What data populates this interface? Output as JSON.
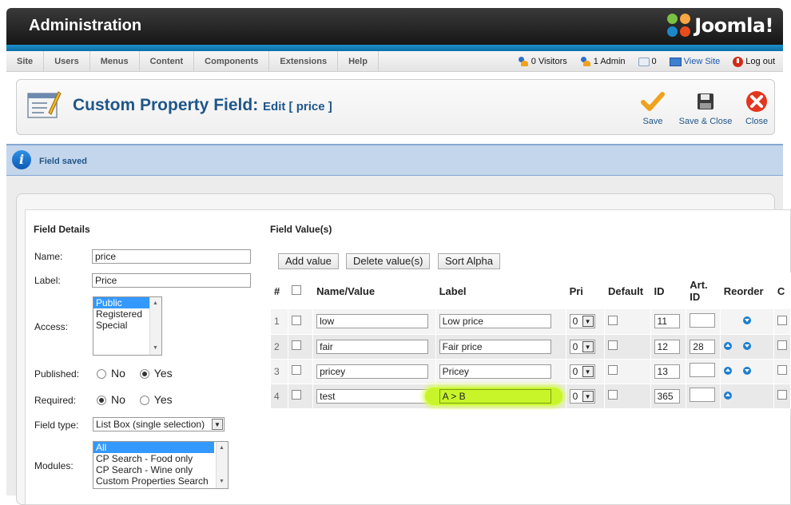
{
  "header": {
    "title": "Administration",
    "brand": "Joomla!"
  },
  "menu": {
    "items": [
      "Site",
      "Users",
      "Menus",
      "Content",
      "Components",
      "Extensions",
      "Help"
    ],
    "visitors": "0 Visitors",
    "admins": "1 Admin",
    "messages": "0",
    "view_site": "View Site",
    "logout": "Log out"
  },
  "toolbar": {
    "title": "Custom Property Field:",
    "subtitle": "Edit [ price ]",
    "save": "Save",
    "save_close": "Save & Close",
    "close": "Close"
  },
  "message": {
    "text": "Field saved"
  },
  "details": {
    "title": "Field Details",
    "name_label": "Name:",
    "name_value": "price",
    "label_label": "Label:",
    "label_value": "Price",
    "access_label": "Access:",
    "access_options": [
      "Public",
      "Registered",
      "Special"
    ],
    "access_selected": "Public",
    "published_label": "Published:",
    "published_no": "No",
    "published_yes": "Yes",
    "published_value": "Yes",
    "required_label": "Required:",
    "required_no": "No",
    "required_yes": "Yes",
    "required_value": "No",
    "fieldtype_label": "Field type:",
    "fieldtype_value": "List Box (single selection)",
    "modules_label": "Modules:",
    "modules_options": [
      "All",
      "CP Search - Food only",
      "CP Search - Wine only",
      "Custom Properties Search"
    ],
    "modules_selected": "All"
  },
  "values": {
    "title": "Field Value(s)",
    "add_label": "Add value",
    "delete_label": "Delete value(s)",
    "sort_label": "Sort Alpha",
    "columns": {
      "num": "#",
      "name": "Name/Value",
      "label": "Label",
      "pri": "Pri",
      "default": "Default",
      "id": "ID",
      "artid": "Art. ID",
      "reorder": "Reorder",
      "extra": "C"
    },
    "rows": [
      {
        "num": "1",
        "name": "low",
        "label": "Low price",
        "pri": "0",
        "id": "11",
        "artid": "",
        "up": false,
        "down": true
      },
      {
        "num": "2",
        "name": "fair",
        "label": "Fair price",
        "pri": "0",
        "id": "12",
        "artid": "28",
        "up": true,
        "down": true
      },
      {
        "num": "3",
        "name": "pricey",
        "label": "Pricey",
        "pri": "0",
        "id": "13",
        "artid": "",
        "up": true,
        "down": true
      },
      {
        "num": "4",
        "name": "test",
        "label": "A > B",
        "pri": "0",
        "id": "365",
        "artid": "",
        "up": true,
        "down": false
      }
    ],
    "highlight_color": "#c8f52a"
  },
  "colors": {
    "accent": "#1f5689",
    "header_bg": "#161616",
    "strip": "#1e8fc7",
    "message_bg": "#c4d6eb"
  }
}
